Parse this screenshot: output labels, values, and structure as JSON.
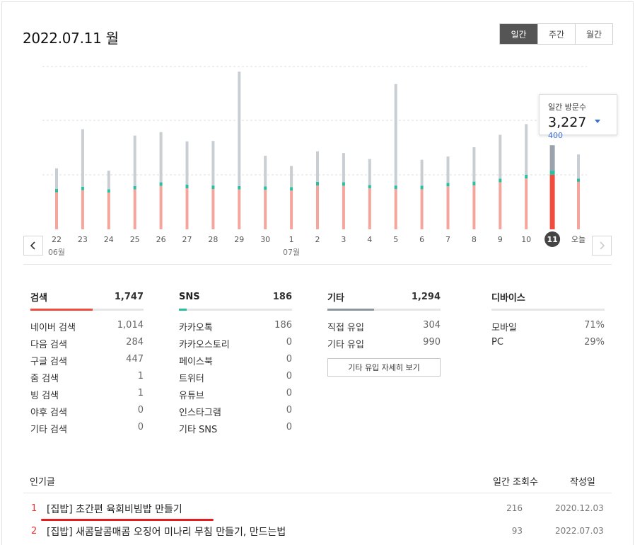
{
  "header": {
    "date_title": "2022.07.11 월"
  },
  "period_tabs": [
    {
      "label": "일간",
      "active": true
    },
    {
      "label": "주간",
      "active": false
    },
    {
      "label": "월간",
      "active": false
    }
  ],
  "icons": {
    "prev": "chevron-left-icon",
    "next": "chevron-right-icon",
    "change": "triangle-down-icon"
  },
  "colors": {
    "search": "#f5a59c",
    "sns": "#2bbfa0",
    "other": "#c9ced3",
    "selected_search": "#f04b3c",
    "selected_other": "#9aa3ad",
    "accent_red": "#e21d1d"
  },
  "chart_data": {
    "type": "bar",
    "stacked": true,
    "categories": [
      "22",
      "23",
      "24",
      "25",
      "26",
      "27",
      "28",
      "29",
      "30",
      "1",
      "2",
      "3",
      "4",
      "5",
      "6",
      "7",
      "8",
      "9",
      "10",
      "11",
      "오늘"
    ],
    "month_labels": [
      {
        "label": "06월",
        "index": 0
      },
      {
        "label": "07월",
        "index": 9
      }
    ],
    "selected_index": 19,
    "series": [
      {
        "values": [
          1900,
          2000,
          1880,
          2040,
          2220,
          2100,
          2060,
          2040,
          2020,
          1990,
          2240,
          2230,
          2100,
          2060,
          2050,
          2200,
          2250,
          2410,
          2600,
          2790,
          2430
        ]
      },
      {
        "values": [
          170,
          180,
          170,
          175,
          185,
          190,
          180,
          175,
          180,
          170,
          190,
          185,
          170,
          180,
          180,
          175,
          190,
          185,
          190,
          186,
          160
        ]
      },
      {
        "values": [
          1050,
          2940,
          950,
          2580,
          2570,
          2210,
          2280,
          5850,
          1560,
          1080,
          1560,
          1490,
          1330,
          5190,
          1330,
          1350,
          1760,
          2240,
          2590,
          1294,
          1240
        ]
      }
    ],
    "ylim": [
      0,
      8400
    ],
    "grid": true
  },
  "tooltip": {
    "label": "일간 방문수",
    "value": "3,227",
    "change": "400"
  },
  "stats": [
    {
      "name": "검색",
      "total": "1,747",
      "color": "#f04b3c",
      "fill": 0.55,
      "rows": [
        {
          "label": "네이버 검색",
          "value": "1,014"
        },
        {
          "label": "다음 검색",
          "value": "284"
        },
        {
          "label": "구글 검색",
          "value": "447"
        },
        {
          "label": "줌 검색",
          "value": "1"
        },
        {
          "label": "빙 검색",
          "value": "1"
        },
        {
          "label": "야후 검색",
          "value": "0"
        },
        {
          "label": "기타 검색",
          "value": "0"
        }
      ]
    },
    {
      "name": "SNS",
      "total": "186",
      "color": "#2bbfa0",
      "fill": 0.07,
      "rows": [
        {
          "label": "카카오톡",
          "value": "186"
        },
        {
          "label": "카카오스토리",
          "value": "0"
        },
        {
          "label": "페이스북",
          "value": "0"
        },
        {
          "label": "트위터",
          "value": "0"
        },
        {
          "label": "유튜브",
          "value": "0"
        },
        {
          "label": "인스타그램",
          "value": "0"
        },
        {
          "label": "기타 SNS",
          "value": "0"
        }
      ]
    },
    {
      "name": "기타",
      "total": "1,294",
      "color": "#8d97a1",
      "fill": 0.41,
      "rows": [
        {
          "label": "직접 유입",
          "value": "304"
        },
        {
          "label": "기타 유입",
          "value": "990"
        }
      ],
      "button": "기타 유입 자세히 보기"
    },
    {
      "name": "디바이스",
      "total": "",
      "color": "",
      "fill": 0,
      "rows": [
        {
          "label": "모바일",
          "value": "71%"
        },
        {
          "label": "PC",
          "value": "29%"
        }
      ]
    }
  ],
  "popular": {
    "headers": {
      "title": "인기글",
      "views": "일간 조회수",
      "date": "작성일"
    },
    "rows": [
      {
        "rank": "1",
        "title": "[집밥] 초간편 육회비빔밥 만들기",
        "views": "216",
        "date": "2020.12.03"
      },
      {
        "rank": "2",
        "title": "[집밥] 새콤달콤매콤 오징어 미나리 무침 만들기, 만드는법",
        "views": "93",
        "date": "2022.07.03"
      }
    ]
  }
}
